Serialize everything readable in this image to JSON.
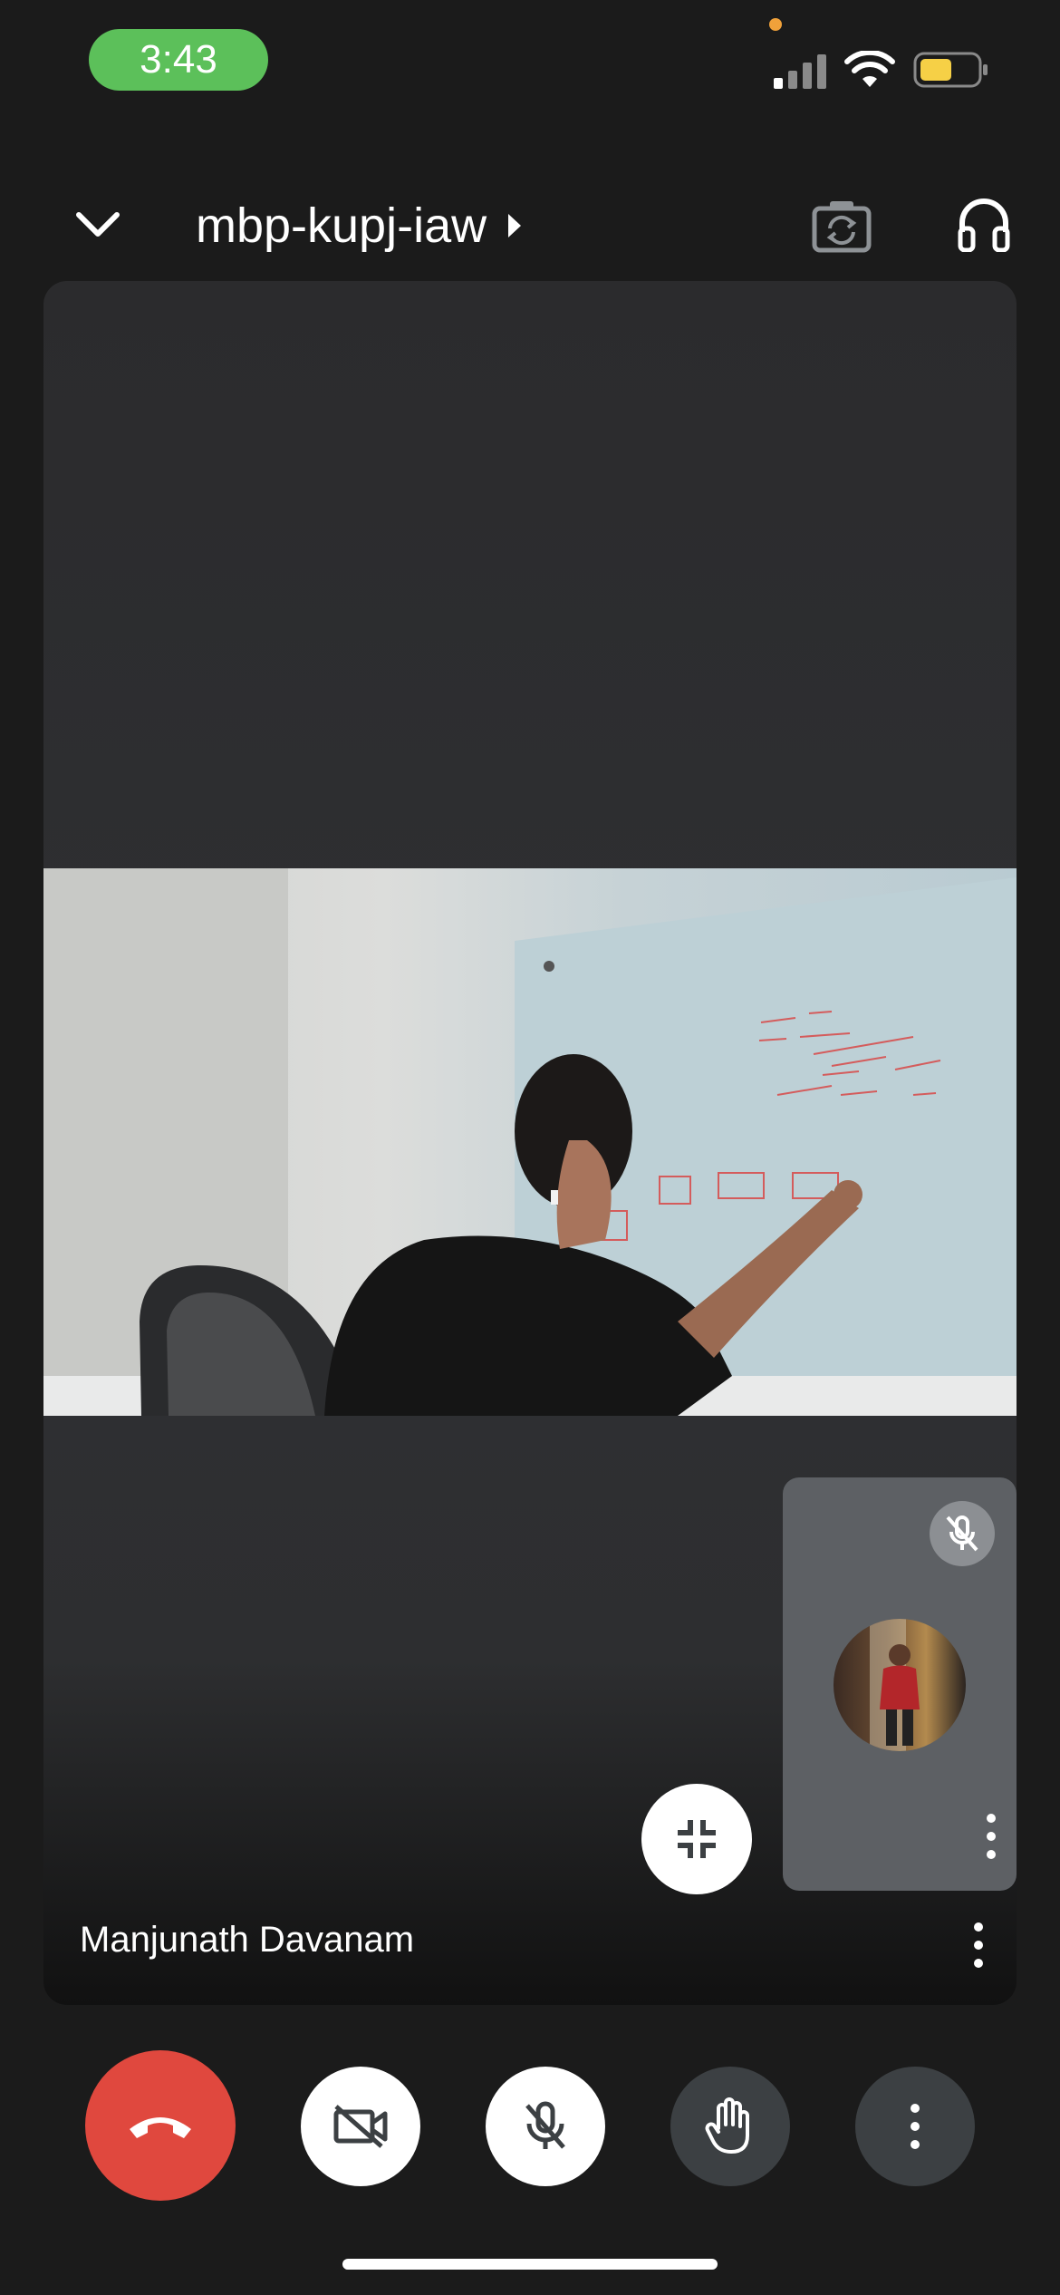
{
  "status_bar": {
    "time": "3:43",
    "icons": [
      "signal-icon",
      "wifi-icon",
      "battery-icon"
    ]
  },
  "header": {
    "meeting_code": "mbp-kupj-iaw",
    "icons": [
      "chevron-down-icon",
      "chevron-right-icon",
      "camera-switch-icon",
      "headphones-icon"
    ]
  },
  "stage": {
    "participant_name": "Manjunath Davanam",
    "icons": [
      "minimize-icon",
      "more-vertical-icon"
    ]
  },
  "self_view": {
    "icons": [
      "mic-off-icon",
      "more-vertical-icon"
    ]
  },
  "controls": {
    "items": [
      "end-call-button",
      "camera-off-button",
      "mic-off-button",
      "raise-hand-button",
      "more-options-button"
    ]
  },
  "colors": {
    "end_call": "#e0483e",
    "status_pill": "#5cc05a",
    "battery": "#f6d046",
    "accent_dot": "#f0a13a",
    "whiteboard_ink": "#d45c5c"
  }
}
